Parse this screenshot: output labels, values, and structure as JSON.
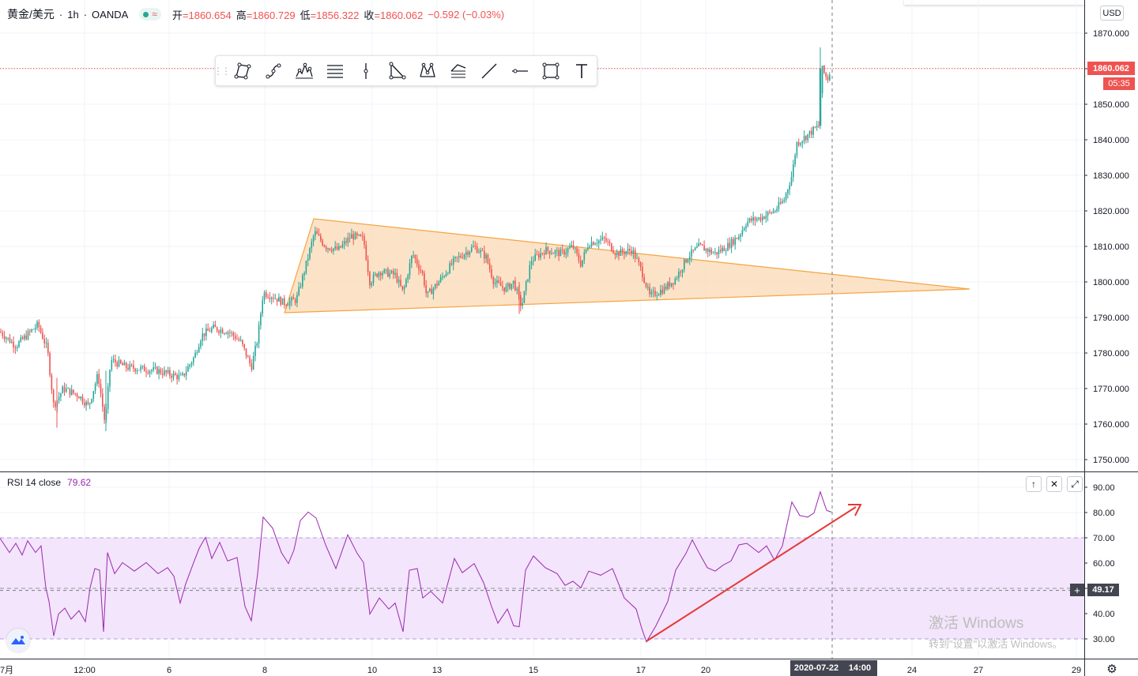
{
  "header": {
    "symbol": "黄金/美元",
    "sep1": "·",
    "interval": "1h",
    "sep2": "·",
    "broker": "OANDA",
    "wave_icon": "≈",
    "ohlc": [
      {
        "k": "开",
        "v": "=1860.654"
      },
      {
        "k": "高",
        "v": "=1860.729"
      },
      {
        "k": "低",
        "v": "=1856.322"
      },
      {
        "k": "收",
        "v": "=1860.062"
      }
    ],
    "change": "−0.592 (−0.03%)"
  },
  "toolbar": {
    "tools": [
      {
        "name": "polyline-tool-icon"
      },
      {
        "name": "curve-tool-icon"
      },
      {
        "name": "elliott-wave-tool-icon"
      },
      {
        "name": "fib-retracement-tool-icon"
      },
      {
        "name": "vertical-line-tool-icon"
      },
      {
        "name": "triangle-pattern-tool-icon"
      },
      {
        "name": "xabcd-pattern-tool-icon"
      },
      {
        "name": "fib-extension-tool-icon"
      },
      {
        "name": "trend-line-tool-icon"
      },
      {
        "name": "horizontal-ray-tool-icon"
      },
      {
        "name": "rectangle-tool-icon"
      },
      {
        "name": "text-tool-icon"
      }
    ]
  },
  "price_axis": {
    "currency": "USD",
    "ticks": [
      "1870.000",
      "1860.000",
      "1850.000",
      "1840.000",
      "1830.000",
      "1820.000",
      "1810.000",
      "1800.000",
      "1790.000",
      "1780.000",
      "1770.000",
      "1760.000",
      "1750.000"
    ],
    "last_price": "1860.062",
    "countdown": "05:35"
  },
  "rsi": {
    "label": "RSI 14 close",
    "value": "79.62",
    "ticks": [
      "90.00",
      "80.00",
      "70.00",
      "60.00",
      "50.00",
      "40.00",
      "30.00"
    ],
    "crosshair_value": "49.17",
    "buttons": {
      "up": "↑",
      "close": "✕",
      "maximize": "⤢"
    }
  },
  "time_axis": {
    "ticks": [
      "7月",
      "12:00",
      "6",
      "8",
      "10",
      "13",
      "15",
      "17",
      "20",
      "24",
      "27",
      "29"
    ],
    "crosshair_date": "2020-07-22",
    "crosshair_time": "14:00"
  },
  "watermark": {
    "line1": "激活 Windows",
    "line2": "转到\"设置\"以激活 Windows。"
  },
  "colors": {
    "up": "#26a69a",
    "down": "#ef5350",
    "rsi_line": "#9c27b0",
    "rsi_band": "#f3e5fb",
    "triangle_fill": "#fbd9b4",
    "triangle_stroke": "#f5a442",
    "arrow": "#e53935"
  }
}
